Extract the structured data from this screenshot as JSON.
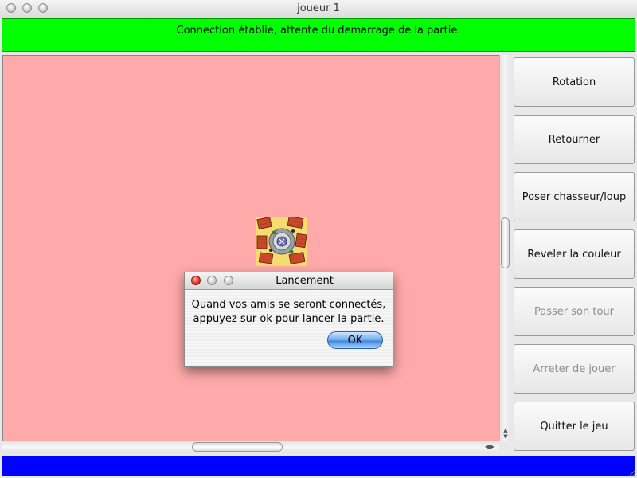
{
  "window": {
    "title": "joueur 1"
  },
  "status": {
    "message": "Connection établie, attente du demarrage de la partie."
  },
  "actions": [
    {
      "label": "Rotation",
      "enabled": true
    },
    {
      "label": "Retourner",
      "enabled": true
    },
    {
      "label": "Poser chasseur/loup",
      "enabled": true
    },
    {
      "label": "Reveler la couleur",
      "enabled": true
    },
    {
      "label": "Passer son tour",
      "enabled": false
    },
    {
      "label": "Arreter de jouer",
      "enabled": false
    },
    {
      "label": "Quitter le jeu",
      "enabled": true
    }
  ],
  "board": {
    "background": "#ffaaaa",
    "tile_icon": "village-tile-icon"
  },
  "dialog": {
    "title": "Lancement",
    "message_line1": "Quand vos amis se seront connectés,",
    "message_line2": "appuyez sur ok pour lancer la partie.",
    "ok_label": "OK"
  },
  "colors": {
    "status_bar": "#00ff00",
    "bottom_bar": "#0000ff"
  }
}
